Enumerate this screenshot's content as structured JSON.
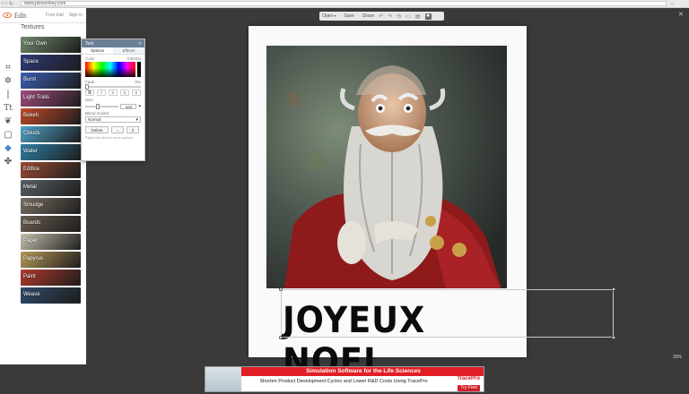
{
  "browser": {
    "url": "www.picmonkey.com"
  },
  "brand": {
    "name": "Edit",
    "free_trial": "Free trial",
    "sign_in": "Sign in"
  },
  "sidebar": {
    "title": "Textures",
    "tools": [
      "crop-icon",
      "magic-wand-icon",
      "brush-icon",
      "text-icon",
      "butterfly-icon",
      "frame-icon",
      "textures-icon",
      "overlay-icon"
    ],
    "items": [
      {
        "label": "Your Own",
        "color": "#6f8a6a"
      },
      {
        "label": "Space",
        "color": "#2e3a78"
      },
      {
        "label": "Burst",
        "color": "#3c5fb6"
      },
      {
        "label": "Light Trails",
        "color": "#a14c7e"
      },
      {
        "label": "Bokeh",
        "color": "#c24a2a"
      },
      {
        "label": "Clouds",
        "color": "#4fa3c9"
      },
      {
        "label": "Water",
        "color": "#2e7fa5"
      },
      {
        "label": "Edifice",
        "color": "#9a4a36"
      },
      {
        "label": "Metal",
        "color": "#5a5f66"
      },
      {
        "label": "Smudge",
        "color": "#7a6e63"
      },
      {
        "label": "Boards",
        "color": "#6a5e52"
      },
      {
        "label": "Paper",
        "color": "#c7bfae"
      },
      {
        "label": "Papyrus",
        "color": "#b79a58"
      },
      {
        "label": "Paint",
        "color": "#b0382c"
      },
      {
        "label": "Weave",
        "color": "#2f4a6b"
      }
    ]
  },
  "text_panel": {
    "title": "Text",
    "close": "×",
    "tabs": [
      "Options",
      "Effects"
    ],
    "color_label": "Color",
    "color_value": "040404",
    "fade_label": "Fade",
    "fade_value": "0%",
    "size_label": "Size",
    "size_value": "444",
    "blend_label": "Blend modes:",
    "blend_value": "Normal",
    "delete_label": "Delete",
    "hint": "Right-click text for more options"
  },
  "toolbar": {
    "open": "Open",
    "save": "Save",
    "share": "Share"
  },
  "canvas": {
    "caption": "JOYEUX NOEL",
    "zoom": "33%"
  },
  "ad": {
    "headline": "Simulation Software for the Life Sciences",
    "tagline": "Shorten Product Development Cycles and Lower R&D Costs Using TracePro",
    "brand": "TracePro",
    "cta": "Try Free"
  },
  "colors": {
    "accent": "#4a86c8",
    "panel_header": "#6b7f95",
    "ad_red": "#e21f27"
  }
}
